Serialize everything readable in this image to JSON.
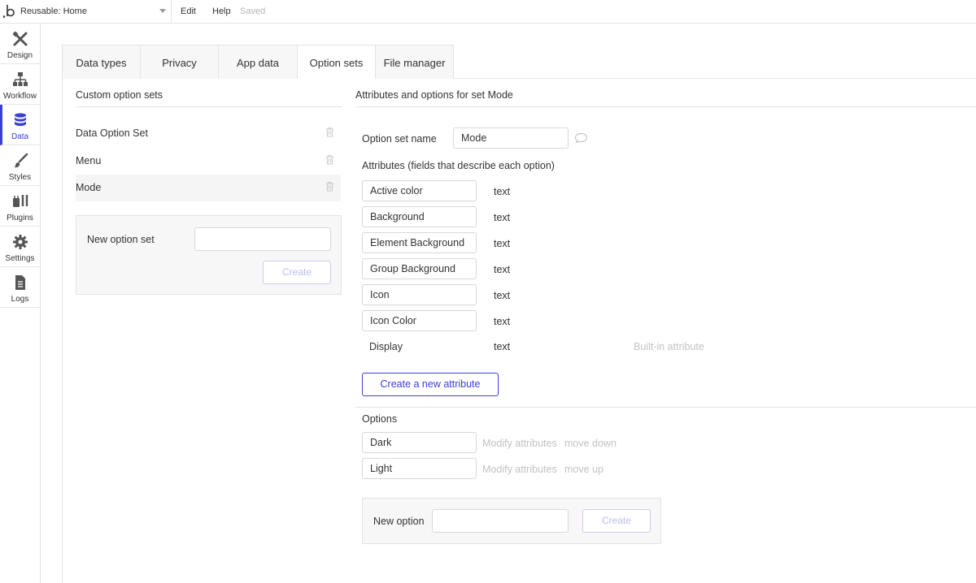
{
  "topbar": {
    "page_selector": "Reusable: Home",
    "menu_edit": "Edit",
    "menu_help": "Help",
    "save_status": "Saved"
  },
  "sidebar": {
    "items": [
      {
        "label": "Design",
        "icon": "design-icon"
      },
      {
        "label": "Workflow",
        "icon": "workflow-icon"
      },
      {
        "label": "Data",
        "icon": "database-icon",
        "active": true
      },
      {
        "label": "Styles",
        "icon": "brush-icon"
      },
      {
        "label": "Plugins",
        "icon": "plug-icon"
      },
      {
        "label": "Settings",
        "icon": "gear-icon"
      },
      {
        "label": "Logs",
        "icon": "document-icon"
      }
    ]
  },
  "tabs": [
    {
      "label": "Data types"
    },
    {
      "label": "Privacy"
    },
    {
      "label": "App data"
    },
    {
      "label": "Option sets",
      "active": true
    },
    {
      "label": "File manager"
    }
  ],
  "option_sets": {
    "title": "Custom option sets",
    "sets": [
      {
        "name": "Data Option Set"
      },
      {
        "name": "Menu"
      },
      {
        "name": "Mode",
        "selected": true
      }
    ],
    "new_set_label": "New option set",
    "new_set_value": "",
    "create_label": "Create"
  },
  "detail": {
    "title": "Attributes and options for set Mode",
    "name_label": "Option set name",
    "name_value": "Mode",
    "attributes_label": "Attributes (fields that describe each option)",
    "attributes": [
      {
        "name": "Active color",
        "type": "text"
      },
      {
        "name": "Background",
        "type": "text"
      },
      {
        "name": "Element Background",
        "type": "text"
      },
      {
        "name": "Group Background",
        "type": "text"
      },
      {
        "name": "Icon",
        "type": "text"
      },
      {
        "name": "Icon Color",
        "type": "text"
      },
      {
        "name": "Display",
        "type": "text",
        "note": "Built-in attribute"
      }
    ],
    "create_attribute_label": "Create a new attribute",
    "options_label": "Options",
    "options": [
      {
        "name": "Dark",
        "modify": "Modify attributes",
        "move": "move down"
      },
      {
        "name": "Light",
        "modify": "Modify attributes",
        "move": "move up"
      }
    ],
    "new_option_label": "New option",
    "new_option_value": "",
    "create_option_label": "Create"
  },
  "colors": {
    "accent": "#3b3fd8",
    "muted_text": "#c2c2c2",
    "border": "#e3e3e3",
    "panel_bg": "#f7f7f7"
  }
}
